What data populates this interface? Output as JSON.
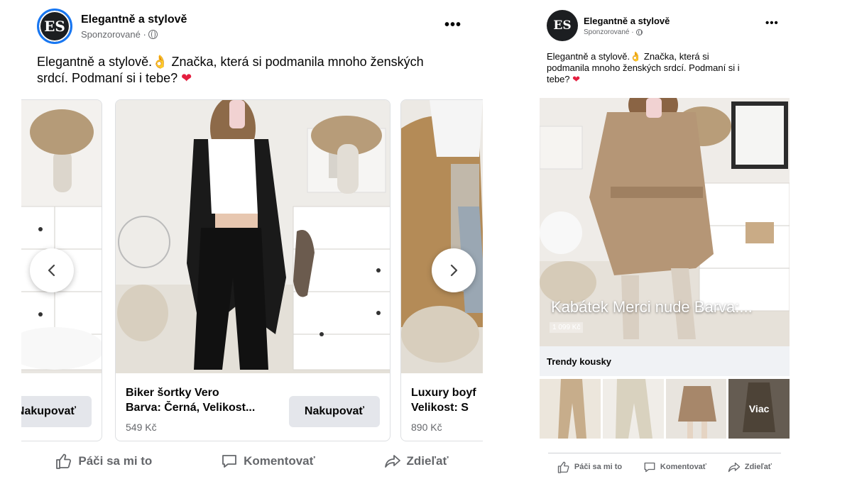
{
  "post_a": {
    "page_name": "Elegantně a stylově",
    "sponsored": "Sponzorované ·",
    "avatar_initials": "ES",
    "caption_line1": "Elegantně a stylově.👌 Značka, která si podmanila mnoho ženských",
    "caption_line2": "srdcí. Podmaní si i tebe?",
    "heart": "❤",
    "cards": [
      {
        "title_line1": "",
        "title_line2": "",
        "price": "",
        "button": "Nakupovať"
      },
      {
        "title_line1": "Biker šortky Vero",
        "title_line2": "Barva: Černá, Velikost...",
        "price": "549 Kč",
        "button": "Nakupovať"
      },
      {
        "title_line1": "Luxury boyf",
        "title_line2": "Velikost: S",
        "price": "890 Kč",
        "button": ""
      }
    ],
    "actions": {
      "like": "Páči sa mi to",
      "comment": "Komentovať",
      "share": "Zdieľať"
    }
  },
  "post_b": {
    "page_name": "Elegantně a stylově",
    "sponsored": "Sponzorované ·",
    "avatar_initials": "ES",
    "caption_line1": "Elegantně a stylově.👌 Značka, která si",
    "caption_line2": "podmanila mnoho ženských srdcí. Podmaní si i",
    "caption_line3": "tebe?",
    "heart": "❤",
    "overlay_title": "Kabátek Merci nude Barva:...",
    "overlay_price": "1 099 Kč",
    "collection_label": "Trendy kousky",
    "more_label": "Viac",
    "actions": {
      "like": "Páči sa mi to",
      "comment": "Komentovať",
      "share": "Zdieľať"
    }
  },
  "icons": {
    "more": "more-dots-icon",
    "globe": "globe-icon",
    "like": "thumbs-up-icon",
    "comment": "comment-icon",
    "share": "share-icon",
    "prev": "chevron-left-icon",
    "next": "chevron-right-icon"
  },
  "colors": {
    "brand": "#1877f2",
    "heart": "#e41e3f",
    "secondary_text": "#65676b",
    "button_bg": "#e4e6eb"
  }
}
